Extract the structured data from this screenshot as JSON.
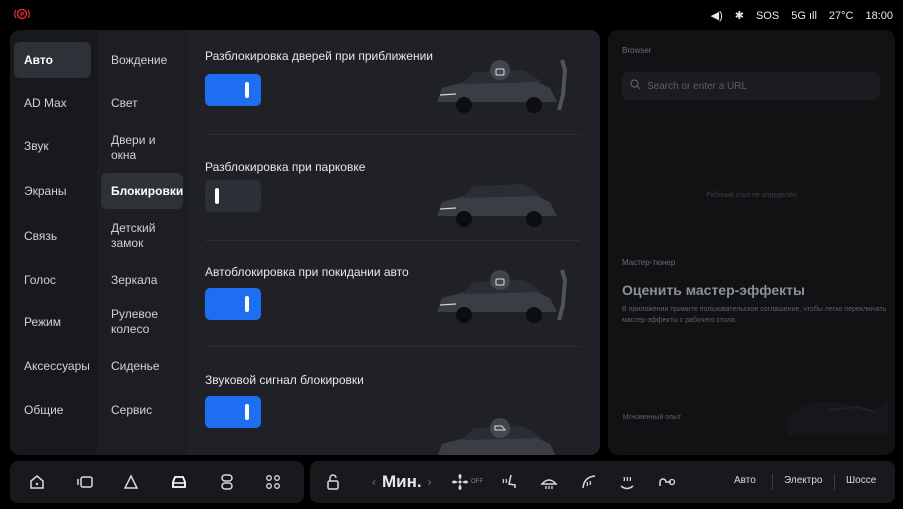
{
  "status": {
    "left_icon": "parking-brake-icon",
    "volume_icon": "volume-icon",
    "bluetooth_icon": "bluetooth-icon",
    "sos": "SOS",
    "signal": "5G",
    "temperature": "27°C",
    "time": "18:00"
  },
  "menu_primary": [
    "Авто",
    "AD Max",
    "Звук",
    "Экраны",
    "Связь",
    "Голос",
    "Режим",
    "Аксессуары",
    "Общие"
  ],
  "menu_secondary": [
    "Вождение",
    "Свет",
    "Двери и окна",
    "Блокировки",
    "Детский замок",
    "Зеркала",
    "Рулевое колесо",
    "Сиденье",
    "Сервис"
  ],
  "settings": [
    {
      "label": "Разблокировка дверей при приближении",
      "on": true
    },
    {
      "label": "Разблокировка при парковке",
      "on": false
    },
    {
      "label": "Автоблокировка при покидании авто",
      "on": true
    },
    {
      "label": "Звуковой сигнал блокировки",
      "on": true
    }
  ],
  "browser": {
    "title": "Browser",
    "search_placeholder": "Search or enter a URL",
    "center_message": "Рабочий стол не определён"
  },
  "master": {
    "section": "Мастер-тюнер",
    "heading": "Оценить мастер-эффекты",
    "description": "В приложении примите пользовательское соглашение, чтобы легко переключать мастер-эффекты с рабочего стола.",
    "instant": "Мгновенный опыт"
  },
  "dock": {
    "left_icons": [
      "home-icon",
      "media-icon",
      "navigation-icon",
      "car-icon",
      "apps-icon",
      "grid-icon"
    ],
    "temperature_label": "Мин.",
    "fan_label": "OFF",
    "modes": [
      "Авто",
      "Электро",
      "Шоссе"
    ]
  },
  "accent": "#1d6ef0"
}
